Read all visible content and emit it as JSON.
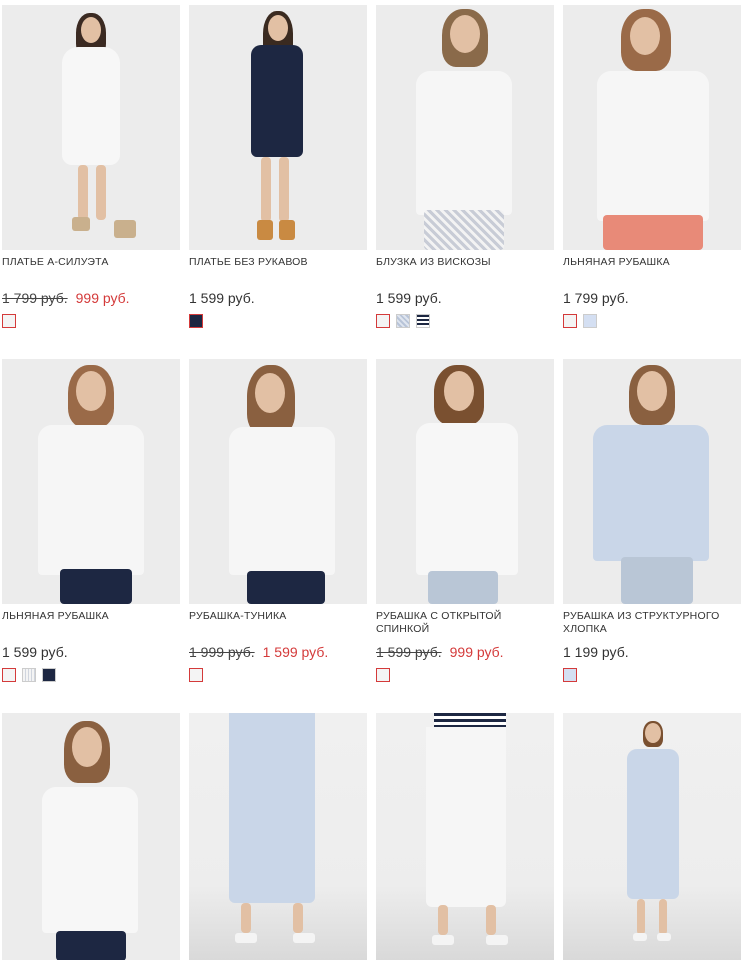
{
  "products": [
    {
      "name": "ПЛАТЬЕ А-СИЛУЭТА",
      "old_price": "1 799 руб.",
      "price": "999 руб.",
      "on_sale": true,
      "colors": [
        "white-swatch"
      ],
      "selected": 0
    },
    {
      "name": "ПЛАТЬЕ БЕЗ РУКАВОВ",
      "old_price": "",
      "price": "1 599 руб.",
      "on_sale": false,
      "colors": [
        "navy-swatch"
      ],
      "selected": 0
    },
    {
      "name": "БЛУЗКА ИЗ ВИСКОЗЫ",
      "old_price": "",
      "price": "1 599 руб.",
      "on_sale": false,
      "colors": [
        "white-swatch",
        "blue-dot-swatch",
        "navy-stripe-swatch"
      ],
      "selected": 0
    },
    {
      "name": "ЛЬНЯНАЯ РУБАШКА",
      "old_price": "",
      "price": "1 799 руб.",
      "on_sale": false,
      "colors": [
        "white-swatch",
        "light-blue-swatch"
      ],
      "selected": 0
    },
    {
      "name": "ЛЬНЯНАЯ РУБАШКА",
      "old_price": "",
      "price": "1 599 руб.",
      "on_sale": false,
      "colors": [
        "white-swatch",
        "pinstripe-swatch",
        "navy-swatch"
      ],
      "selected": 0
    },
    {
      "name": "РУБАШКА-ТУНИКА",
      "old_price": "1 999 руб.",
      "price": "1 599 руб.",
      "on_sale": true,
      "colors": [
        "white-swatch"
      ],
      "selected": 0
    },
    {
      "name": "РУБАШКА С ОТКРЫТОЙ СПИНКОЙ",
      "old_price": "1 599 руб.",
      "price": "999 руб.",
      "on_sale": true,
      "colors": [
        "white-swatch"
      ],
      "selected": 0
    },
    {
      "name": "РУБАШКА ИЗ СТРУКТУРНОГО ХЛОПКА",
      "old_price": "",
      "price": "1 199 руб.",
      "on_sale": false,
      "colors": [
        "light-blue-swatch"
      ],
      "selected": 0
    },
    {
      "name": "",
      "old_price": "",
      "price": "",
      "on_sale": false,
      "colors": [],
      "selected": -1
    },
    {
      "name": "",
      "old_price": "",
      "price": "",
      "on_sale": false,
      "colors": [],
      "selected": -1
    },
    {
      "name": "",
      "old_price": "",
      "price": "",
      "on_sale": false,
      "colors": [],
      "selected": -1
    },
    {
      "name": "",
      "old_price": "",
      "price": "",
      "on_sale": false,
      "colors": [],
      "selected": -1
    }
  ],
  "colors": {
    "sale": "#d43a3a",
    "text": "#333333",
    "photo_bg": "#ececec"
  }
}
